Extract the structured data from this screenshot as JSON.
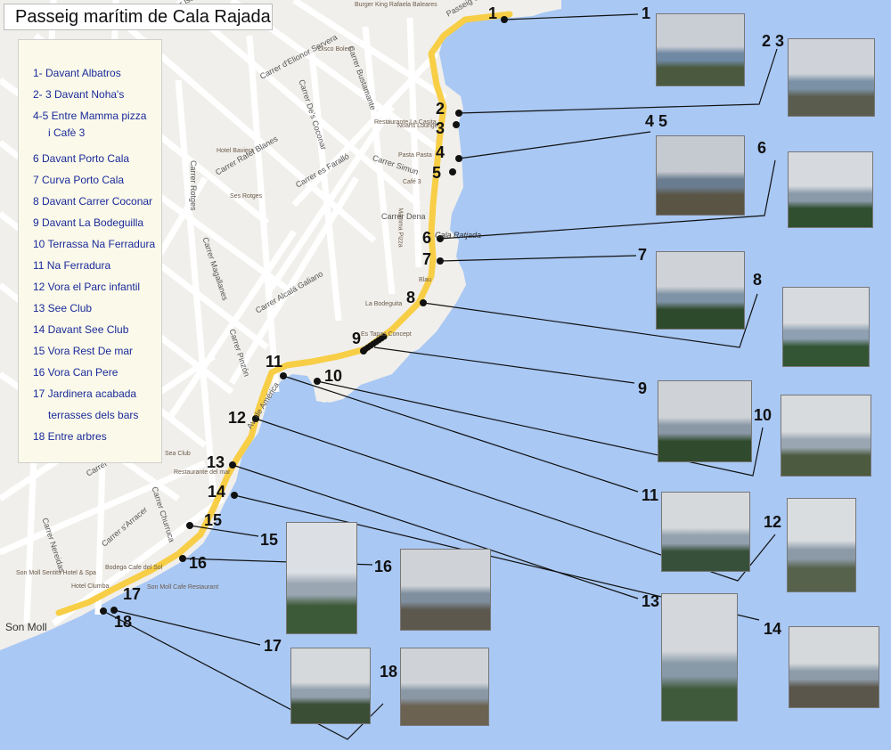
{
  "title": "Passeig marítim de Cala Rajada",
  "legend": [
    "1- Davant Albatros",
    "2- 3 Davant Noha's",
    "4-5 Entre Mamma pizza",
    "i Cafè 3",
    "6 Davant Porto Cala",
    "7 Curva Porto Cala",
    "8 Davant Carrer Coconar",
    "9 Davant La Bodeguilla",
    "10 Terrassa Na Ferradura",
    "11 Na Ferradura",
    "12 Vora el Parc infantil",
    "13 See Club",
    "14 Davant See Club",
    "15 Vora Rest De mar",
    "16 Vora Can Pere",
    "17 Jardinera acabada",
    "terrasses dels bars",
    "18 Entre arbres"
  ],
  "route_labels": [
    "1",
    "2",
    "3",
    "4",
    "5",
    "6",
    "7",
    "8",
    "9",
    "10",
    "11",
    "12",
    "13",
    "14",
    "15",
    "16",
    "17",
    "18"
  ],
  "photo_labels": [
    "1",
    "2 3",
    "4 5",
    "6",
    "7",
    "8",
    "9",
    "10",
    "11",
    "12",
    "13",
    "14",
    "15",
    "16",
    "17",
    "18"
  ],
  "town_labels": {
    "son_moll": "Son Moll",
    "cala_ratjada": "Cala Ratjada"
  },
  "streets": [
    "Passeig Colón",
    "Carrer d'Elionor Servera",
    "Carrer Bustamante",
    "Carrer De's Coconar",
    "Carrer Simun",
    "Carrer Dena",
    "Carrer es Faralló",
    "Carrer Rafel Blanes",
    "Carrer Rotges",
    "Carrer Alcalá Galiano",
    "Carrer Magallanes",
    "Carrer Pinzón",
    "Carrer Tritón",
    "Carrer Churruca",
    "Carrer s'Arracer",
    "Carrer Nereidas",
    "Av. de América",
    "Carrer Isaac"
  ],
  "places": [
    "Burger King Rafaela Baleares",
    "Disco Bolero",
    "Restaurante La Casita",
    "Noahs Lounge",
    "Pasta Pasta",
    "Café 3",
    "Mamma Pizza",
    "Hotel Baviera",
    "Ses Rotges",
    "Blau",
    "La Bodeguita",
    "Es Tapas Concept",
    "Sea Club",
    "Restaurante del mar",
    "Bodega Cafe del Sol",
    "Son Moll Cafe Restaurant",
    "Hotel Clumba",
    "Son Moll Sentits Hotel & Spa"
  ],
  "colors": {
    "sea": "#a9c8f4",
    "land": "#f1efeb",
    "route": "#f7ce46",
    "legend_text": "#1a2a9a",
    "legend_bg": "#fbfaea"
  }
}
